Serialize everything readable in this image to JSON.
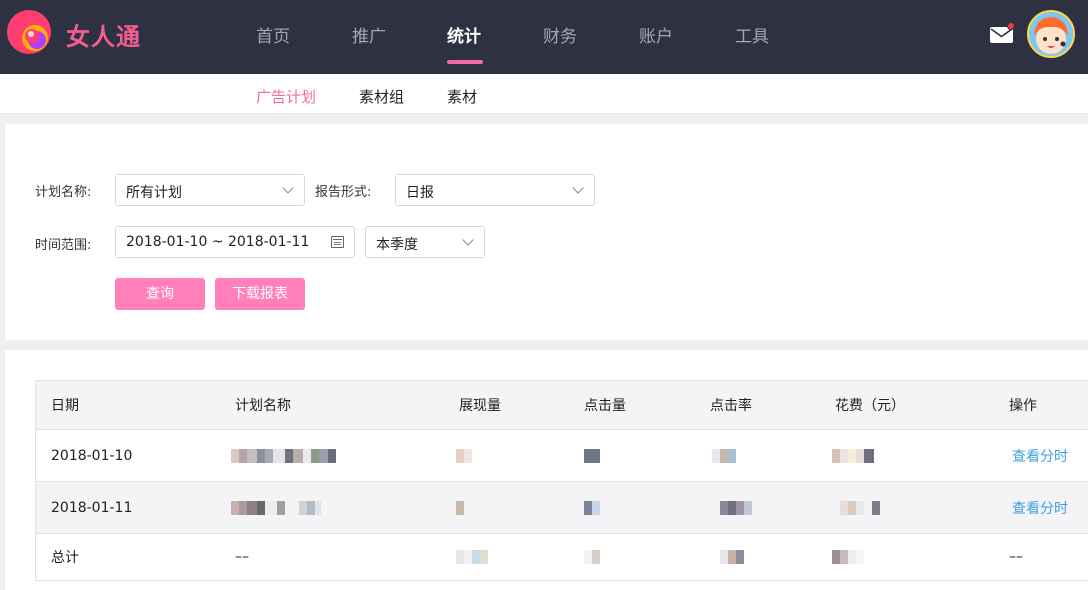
{
  "brand": {
    "name": "女人通",
    "accent": "#f35e8e"
  },
  "nav": {
    "items": [
      "首页",
      "推广",
      "统计",
      "财务",
      "账户",
      "工具"
    ],
    "active": "统计"
  },
  "subnav": {
    "items": [
      "广告计划",
      "素材组",
      "素材"
    ],
    "active": "广告计划"
  },
  "filters": {
    "plan_label": "计划名称:",
    "plan_value": "所有计划",
    "report_label": "报告形式:",
    "report_value": "日报",
    "time_label": "时间范围:",
    "date_range": "2018-01-10 ~ 2018-01-11",
    "period_value": "本季度",
    "query_button": "查询",
    "download_button": "下载报表"
  },
  "table": {
    "headers": [
      "日期",
      "计划名称",
      "展现量",
      "点击量",
      "点击率",
      "花费（元）",
      "操作"
    ],
    "rows": [
      {
        "date": "2018-01-10",
        "action": "查看分时"
      },
      {
        "date": "2018-01-11",
        "action": "查看分时"
      }
    ],
    "total": {
      "label": "总计",
      "plan": "––",
      "action": "––"
    }
  },
  "colors": {
    "topbar": "#2e3141",
    "pink_button": "#ff80bb",
    "link": "#3ea0e0"
  }
}
